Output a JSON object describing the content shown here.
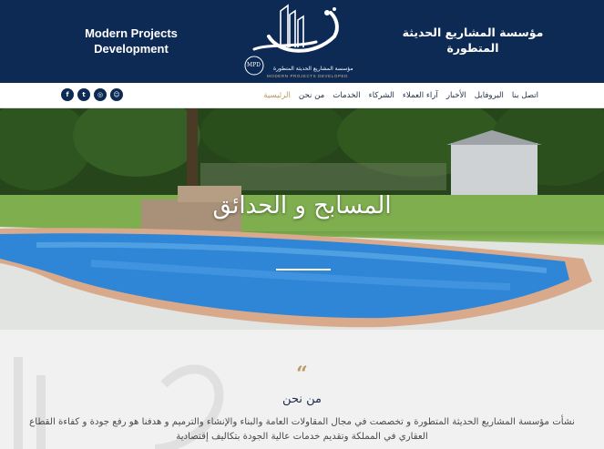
{
  "header": {
    "brand_en": "Modern Projects Development",
    "brand_ar": "مؤسسة المشاريع الحديثة المتطورة",
    "logo_ar": "مؤسسة المشاريع الحديثة المتطورة",
    "logo_en": "MODERN PROJECTS DEVELOPED",
    "logo_badge": "MPD"
  },
  "nav": {
    "items": [
      {
        "label": "الرئيسية"
      },
      {
        "label": "من نحن"
      },
      {
        "label": "الخدمات"
      },
      {
        "label": "الشركاء"
      },
      {
        "label": "آراء العملاء"
      },
      {
        "label": "الأخبار"
      },
      {
        "label": "البروفايل"
      },
      {
        "label": "اتصل بنا"
      }
    ],
    "socials": [
      {
        "icon": "facebook-icon",
        "glyph": "f"
      },
      {
        "icon": "twitter-icon",
        "glyph": "t"
      },
      {
        "icon": "instagram-icon",
        "glyph": "◎"
      },
      {
        "icon": "snapchat-icon",
        "glyph": "☺"
      }
    ]
  },
  "hero": {
    "title": "المسابح و الحدائق"
  },
  "about": {
    "quote": "“",
    "title": "من نحن",
    "text": "نشأت مؤسسة المشاريع الحديثة المتطورة و تخصصت في مجال المقاولات العامة والبناء والإنشاء والترميم و هدفنا هو رفع جودة و كفاءة القطاع العقاري في المملكة وتقديم خدمات عالية الجودة بتكاليف إقتصادية"
  },
  "colors": {
    "navy": "#0d2a55",
    "gold": "#b89a63",
    "active_nav": "#b89a63"
  }
}
